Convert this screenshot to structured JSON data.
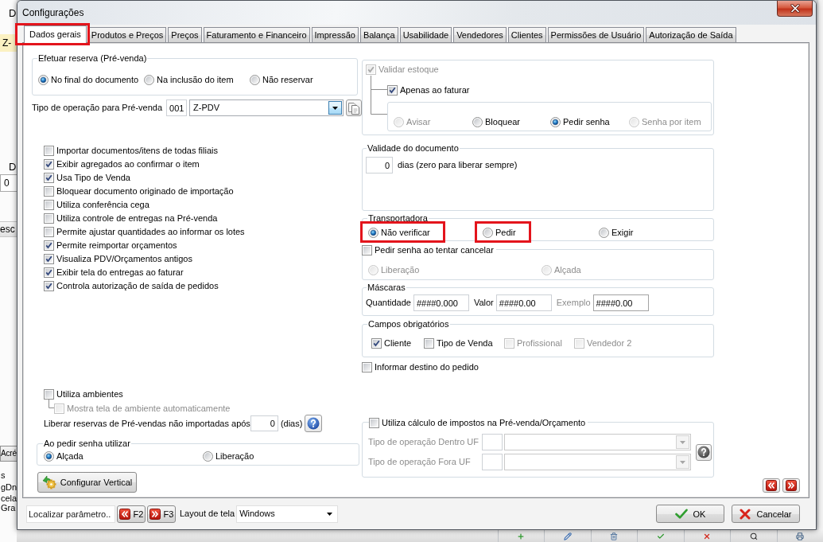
{
  "background_app": {
    "fragments": [
      {
        "kind": "label",
        "text": "D"
      },
      {
        "kind": "combo",
        "text": "Z-"
      },
      {
        "kind": "label",
        "text": "D"
      },
      {
        "kind": "field",
        "text": "0"
      },
      {
        "kind": "header",
        "text": "esc"
      },
      {
        "kind": "button",
        "text": "Acré"
      },
      {
        "kind": "text",
        "text": "s"
      },
      {
        "kind": "text",
        "text": "gDn"
      },
      {
        "kind": "text",
        "text": "cela"
      },
      {
        "kind": "text",
        "text": "Gra"
      }
    ]
  },
  "window": {
    "title": "Configurações"
  },
  "tabs": [
    {
      "label": "Dados gerais",
      "selected": true,
      "highlighted": true
    },
    {
      "label": "Produtos e Preços",
      "selected": false,
      "highlighted": false
    },
    {
      "label": "Preços",
      "selected": false,
      "highlighted": false
    },
    {
      "label": "Faturamento e Financeiro",
      "selected": false,
      "highlighted": false
    },
    {
      "label": "Impressão",
      "selected": false,
      "highlighted": false
    },
    {
      "label": "Balança",
      "selected": false,
      "highlighted": false
    },
    {
      "label": "Usabilidade",
      "selected": false,
      "highlighted": false
    },
    {
      "label": "Vendedores",
      "selected": false,
      "highlighted": false
    },
    {
      "label": "Clientes",
      "selected": false,
      "highlighted": false
    },
    {
      "label": "Permissões de Usuário",
      "selected": false,
      "highlighted": false
    },
    {
      "label": "Autorização de Saída",
      "selected": false,
      "highlighted": false
    }
  ],
  "reserva": {
    "title": "Efetuar reserva (Pré-venda)",
    "options": [
      {
        "label": "No final do documento",
        "selected": true
      },
      {
        "label": "Na inclusão do item",
        "selected": false
      },
      {
        "label": "Não reservar",
        "selected": false
      }
    ]
  },
  "operacao_prevenda": {
    "label": "Tipo de operação para Pré-venda",
    "code": "001",
    "value": "Z-PDV"
  },
  "checklist": [
    {
      "label": "Importar documentos/itens de todas filiais",
      "checked": false
    },
    {
      "label": "Exibir agregados ao confirmar o item",
      "checked": true
    },
    {
      "label": "Usa Tipo de Venda",
      "checked": true
    },
    {
      "label": "Bloquear documento originado de importação",
      "checked": false
    },
    {
      "label": "Utiliza conferência cega",
      "checked": false
    },
    {
      "label": "Utiliza controle de entregas na Pré-venda",
      "checked": false
    },
    {
      "label": "Permite ajustar quantidades ao informar os lotes",
      "checked": false
    },
    {
      "label": "Permite reimportar orçamentos",
      "checked": true
    },
    {
      "label": "Visualiza PDV/Orçamentos antigos",
      "checked": true
    },
    {
      "label": "Exibir tela do entregas ao faturar",
      "checked": true
    },
    {
      "label": "Controla autorização de saída de pedidos",
      "checked": true
    }
  ],
  "ambientes": {
    "label": "Utiliza ambientes",
    "checked": false,
    "children": [
      {
        "label": "Mostra tela de ambiente automaticamente",
        "checked": false,
        "disabled": true
      }
    ]
  },
  "liberar_reservas": {
    "label": "Liberar reservas de Pré-vendas não importadas após",
    "value": "0",
    "unit": "(dias)"
  },
  "ao_pedir_senha": {
    "title": "Ao pedir senha utilizar",
    "options": [
      {
        "label": "Alçada",
        "selected": true
      },
      {
        "label": "Liberação",
        "selected": false
      }
    ]
  },
  "configurar_vertical": {
    "label": "Configurar Vertical"
  },
  "estoque": {
    "validar": {
      "label": "Validar estoque",
      "checked": true,
      "disabled": true
    },
    "apenas_faturar": {
      "label": "Apenas ao faturar",
      "checked": true
    },
    "options": [
      {
        "label": "Avisar",
        "selected": false,
        "disabled": true
      },
      {
        "label": "Bloquear",
        "selected": false,
        "disabled": false
      },
      {
        "label": "Pedir senha",
        "selected": true,
        "disabled": false
      },
      {
        "label": "Senha por item",
        "selected": false,
        "disabled": true
      }
    ]
  },
  "validade": {
    "title": "Validade do documento",
    "value": "0",
    "caption": "dias (zero para liberar sempre)"
  },
  "transportadora": {
    "title": "Transportadora",
    "options": [
      {
        "label": "Não verificar",
        "selected": true,
        "highlighted": true
      },
      {
        "label": "Pedir",
        "selected": false,
        "highlighted": true
      },
      {
        "label": "Exigir",
        "selected": false,
        "highlighted": false
      }
    ]
  },
  "cancelar": {
    "label": "Pedir senha ao tentar cancelar",
    "checked": false,
    "options": [
      {
        "label": "Liberação",
        "selected": false,
        "disabled": true
      },
      {
        "label": "Alçada",
        "selected": false,
        "disabled": true
      }
    ]
  },
  "mascaras": {
    "title": "Máscaras",
    "fields": [
      {
        "label": "Quantidade",
        "value": "####0.000",
        "disabled": false
      },
      {
        "label": "Valor",
        "value": "####0.00",
        "disabled": false
      },
      {
        "label": "Exemplo",
        "value": "####0.00",
        "disabled": true
      }
    ]
  },
  "campos_obrigatorios": {
    "title": "Campos obrigatórios",
    "items": [
      {
        "label": "Cliente",
        "checked": true,
        "disabled": false
      },
      {
        "label": "Tipo de Venda",
        "checked": false,
        "disabled": false
      },
      {
        "label": "Profissional",
        "checked": false,
        "disabled": true
      },
      {
        "label": "Vendedor 2",
        "checked": false,
        "disabled": true
      }
    ]
  },
  "informar_destino": {
    "label": "Informar destino do pedido",
    "checked": false
  },
  "impostos": {
    "label": "Utiliza cálculo de impostos na Pré-venda/Orçamento",
    "checked": false,
    "rows": [
      {
        "label": "Tipo de operação Dentro UF",
        "disabled": true
      },
      {
        "label": "Tipo de operação Fora UF",
        "disabled": true
      }
    ]
  },
  "footer": {
    "search": {
      "placeholder": "Localizar parâmetro.."
    },
    "prev_key": "F2",
    "next_key": "F3",
    "layout": {
      "label": "Layout de tela",
      "value": "Windows"
    },
    "buttons": [
      {
        "kind": "ok",
        "label": "OK"
      },
      {
        "kind": "cancel",
        "label": "Cancelar"
      }
    ]
  }
}
